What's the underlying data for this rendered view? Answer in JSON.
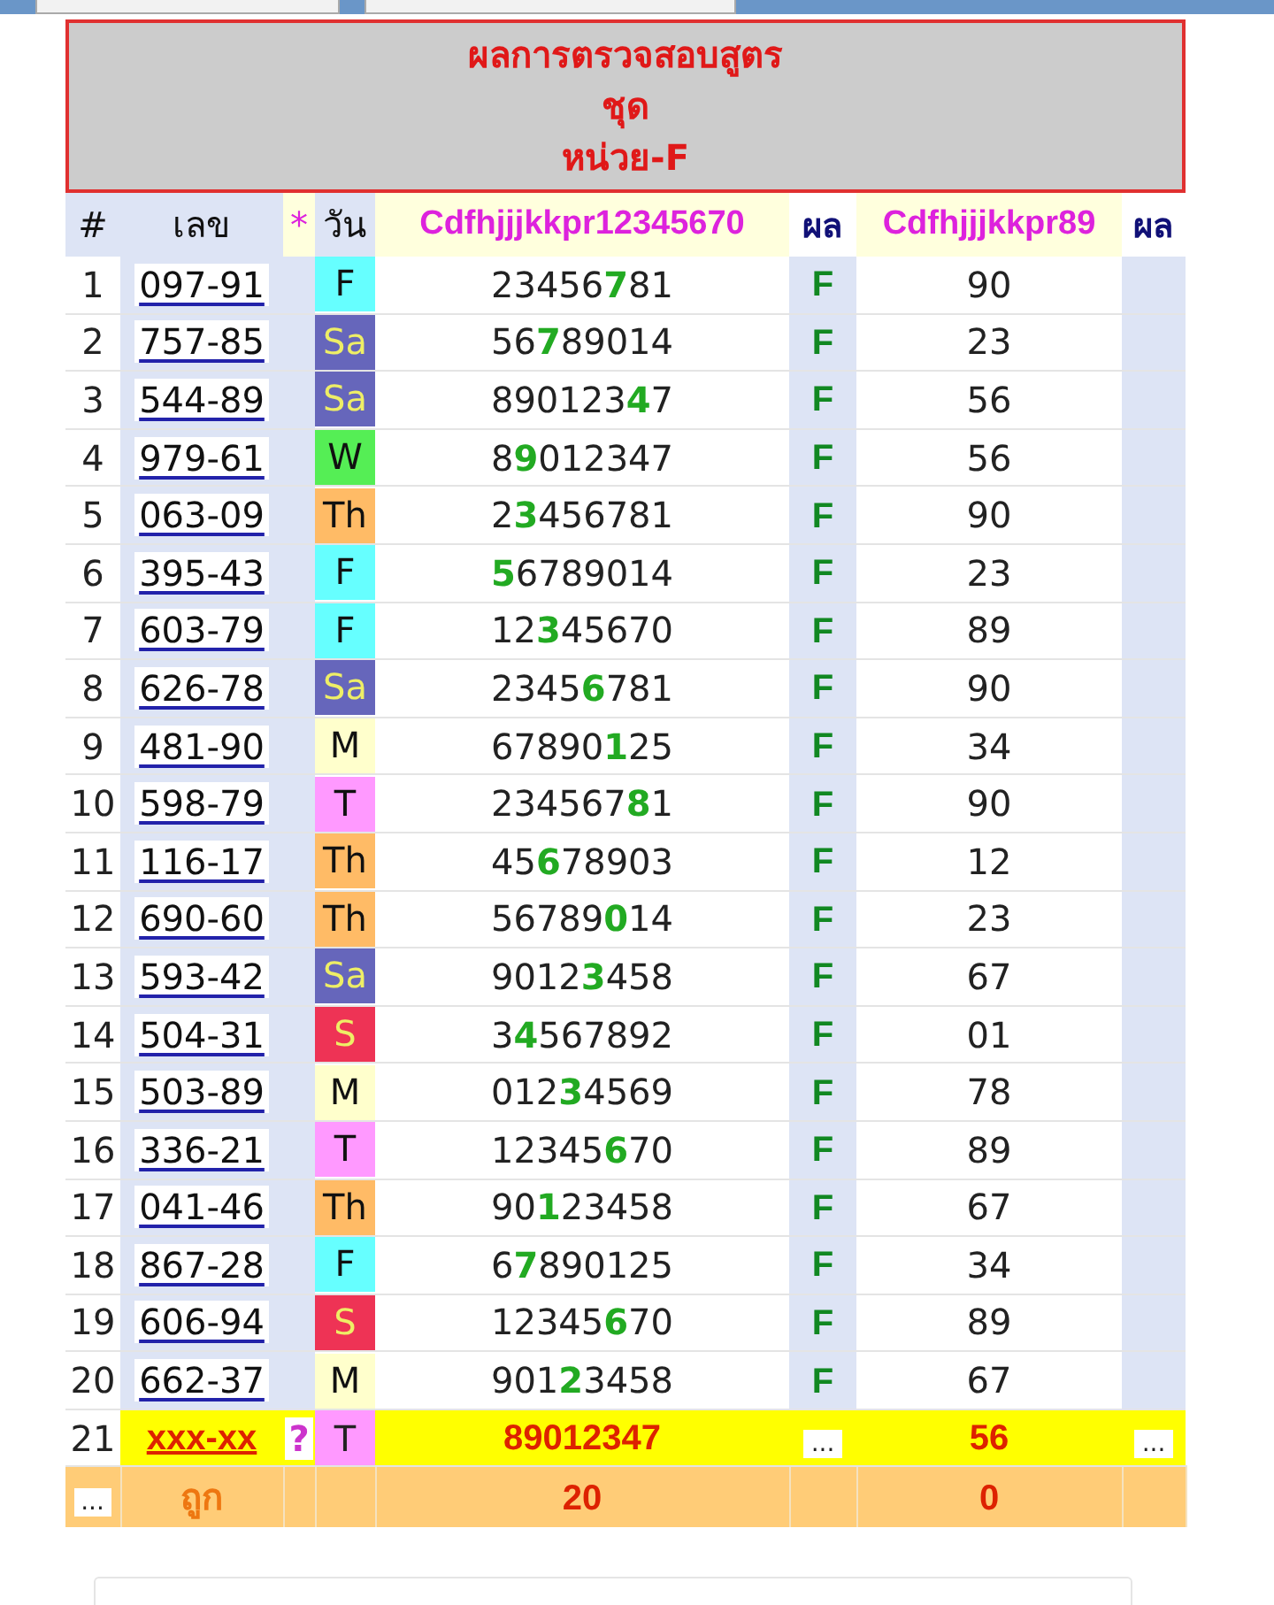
{
  "toolbar_buttons": [
    {
      "kind": "button"
    },
    {
      "kind": "button"
    }
  ],
  "title_lines": [
    "ผลการตรวจสอบสูตร",
    "ชุด",
    "หน่วย-F"
  ],
  "columns": [
    {
      "label": "#",
      "kind": "plain"
    },
    {
      "label": "เลข",
      "kind": "plain"
    },
    {
      "label": "*",
      "kind": "mark"
    },
    {
      "label": "วัน",
      "kind": "plain"
    },
    {
      "label": "Cdfhjjjkkpr12345670",
      "kind": "formula"
    },
    {
      "label": "ผล",
      "kind": "result"
    },
    {
      "label": "Cdfhjjjkkpr89",
      "kind": "formula"
    },
    {
      "label": "ผล",
      "kind": "result"
    }
  ],
  "rows": [
    {
      "num": "1",
      "number": "097-91",
      "day": "F",
      "color": "#66ffff",
      "formula_1": "23456**7**81",
      "result_1": "F",
      "formula_2": "90"
    },
    {
      "num": "2",
      "number": "757-85",
      "day": "Sa",
      "color": "#6666bb",
      "formula_1": "56**7**89014",
      "result_1": "F",
      "formula_2": "23"
    },
    {
      "num": "3",
      "number": "544-89",
      "day": "Sa",
      "color": "#6666bb",
      "formula_1": "890123**4**7",
      "result_1": "F",
      "formula_2": "56"
    },
    {
      "num": "4",
      "number": "979-61",
      "day": "W",
      "color": "#55ee55",
      "formula_1": "8**9**012347",
      "result_1": "F",
      "formula_2": "56"
    },
    {
      "num": "5",
      "number": "063-09",
      "day": "Th",
      "color": "#ffbb66",
      "formula_1": "2**3**456781",
      "result_1": "F",
      "formula_2": "90"
    },
    {
      "num": "6",
      "number": "395-43",
      "day": "F",
      "color": "#66ffff",
      "formula_1": "**5**6789014",
      "result_1": "F",
      "formula_2": "23"
    },
    {
      "num": "7",
      "number": "603-79",
      "day": "F",
      "color": "#66ffff",
      "formula_1": "12**3**45670",
      "result_1": "F",
      "formula_2": "89"
    },
    {
      "num": "8",
      "number": "626-78",
      "day": "Sa",
      "color": "#6666bb",
      "formula_1": "2345**6**781",
      "result_1": "F",
      "formula_2": "90"
    },
    {
      "num": "9",
      "number": "481-90",
      "day": "M",
      "color": "#ffffcc",
      "formula_1": "67890**1**25",
      "result_1": "F",
      "formula_2": "34"
    },
    {
      "num": "10",
      "number": "598-79",
      "day": "T",
      "color": "#ff99ff",
      "formula_1": "234567**8**1",
      "result_1": "F",
      "formula_2": "90"
    },
    {
      "num": "11",
      "number": "116-17",
      "day": "Th",
      "color": "#ffbb66",
      "formula_1": "45**6**78903",
      "result_1": "F",
      "formula_2": "12"
    },
    {
      "num": "12",
      "number": "690-60",
      "day": "Th",
      "color": "#ffbb66",
      "formula_1": "56789**0**14",
      "result_1": "F",
      "formula_2": "23"
    },
    {
      "num": "13",
      "number": "593-42",
      "day": "Sa",
      "color": "#6666bb",
      "formula_1": "9012**3**458",
      "result_1": "F",
      "formula_2": "67"
    },
    {
      "num": "14",
      "number": "504-31",
      "day": "S",
      "color": "#ee3355",
      "formula_1": "3**4**567892",
      "result_1": "F",
      "formula_2": "01"
    },
    {
      "num": "15",
      "number": "503-89",
      "day": "M",
      "color": "#ffffcc",
      "formula_1": "012**3**4569",
      "result_1": "F",
      "formula_2": "78"
    },
    {
      "num": "16",
      "number": "336-21",
      "day": "T",
      "color": "#ff99ff",
      "formula_1": "12345**6**70",
      "result_1": "F",
      "formula_2": "89"
    },
    {
      "num": "17",
      "number": "041-46",
      "day": "Th",
      "color": "#ffbb66",
      "formula_1": "90**1**23458",
      "result_1": "F",
      "formula_2": "67"
    },
    {
      "num": "18",
      "number": "867-28",
      "day": "F",
      "color": "#66ffff",
      "formula_1": "6**7**890125",
      "result_1": "F",
      "formula_2": "34"
    },
    {
      "num": "19",
      "number": "606-94",
      "day": "S",
      "color": "#ee3355",
      "formula_1": "12345**6**70",
      "result_1": "F",
      "formula_2": "89"
    },
    {
      "num": "20",
      "number": "662-37",
      "day": "M",
      "color": "#ffffcc",
      "formula_1": "901**2**3458",
      "result_1": "F",
      "formula_2": "67"
    }
  ],
  "pending_row": {
    "num": "21",
    "number": "xxx-xx",
    "mark": "?",
    "day": "T",
    "color": "#ff99ff",
    "formula_1": "89012347",
    "result_1": "...",
    "formula_2": "56",
    "result_2": "..."
  },
  "summary_row": {
    "more": "...",
    "label": "ถูก",
    "count_1": "20",
    "count_2": "0"
  }
}
